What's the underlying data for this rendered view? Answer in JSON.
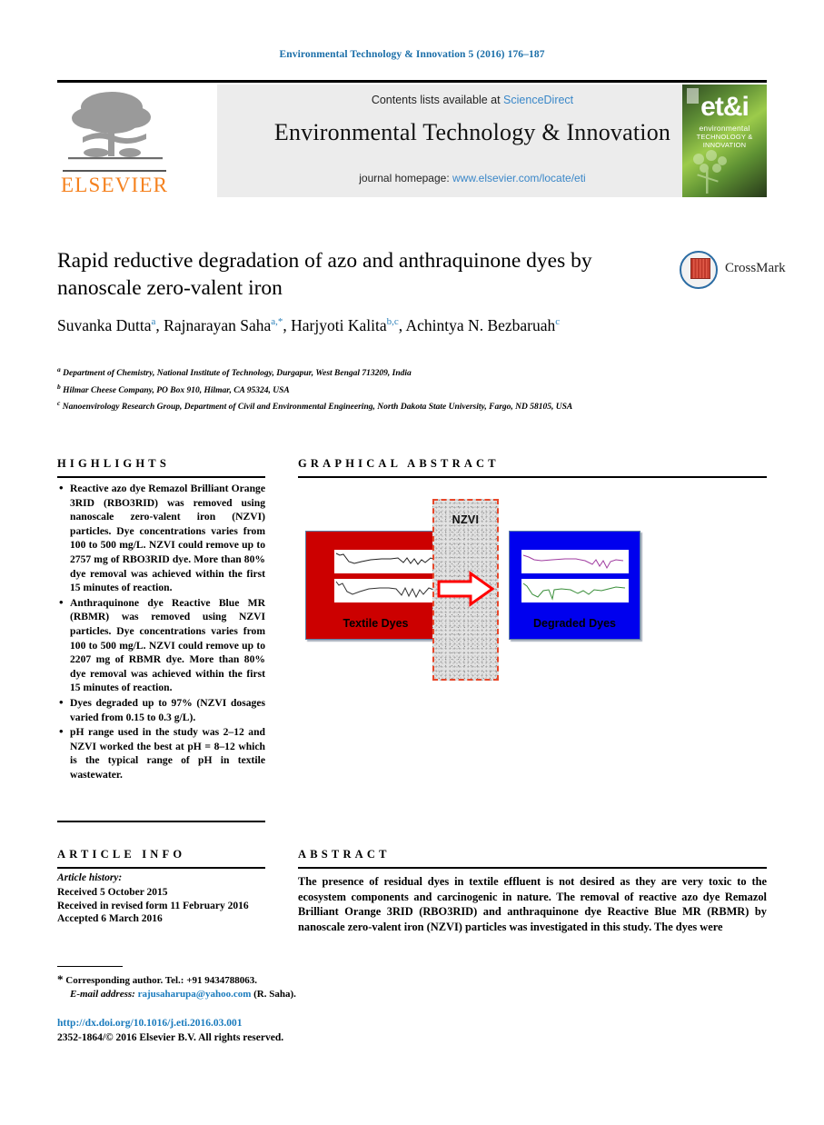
{
  "running_head": "Environmental Technology & Innovation 5 (2016) 176–187",
  "banner": {
    "contents_prefix": "Contents lists available at ",
    "contents_link": "ScienceDirect",
    "journal_title": "Environmental Technology & Innovation",
    "homepage_prefix": "journal homepage: ",
    "homepage_link": "www.elsevier.com/locate/eti",
    "publisher_logo_text": "ELSEVIER",
    "cover": {
      "logo_text": "et&i",
      "line1": "environmental",
      "line2": "TECHNOLOGY &",
      "line3": "INNOVATION"
    }
  },
  "article": {
    "title": "Rapid reductive degradation of azo and anthraquinone dyes by nanoscale zero-valent iron",
    "crossmark_label": "CrossMark",
    "authors": [
      {
        "name": "Suvanka Dutta",
        "marks": "a",
        "sep": ", "
      },
      {
        "name": "Rajnarayan Saha",
        "marks": "a,*",
        "sep": ", "
      },
      {
        "name": "Harjyoti Kalita",
        "marks": "b,c",
        "sep": ", "
      },
      {
        "name": "Achintya N. Bezbaruah",
        "marks": "c",
        "sep": ""
      }
    ],
    "affiliations": [
      {
        "mark": "a",
        "text": "Department of Chemistry, National Institute of Technology, Durgapur, West Bengal 713209, India"
      },
      {
        "mark": "b",
        "text": "Hilmar Cheese Company, PO Box 910, Hilmar, CA 95324, USA"
      },
      {
        "mark": "c",
        "text": "Nanoenvirology Research Group, Department of Civil and Environmental Engineering, North Dakota State University, Fargo, ND 58105, USA"
      }
    ]
  },
  "sections": {
    "highlights_head": "HIGHLIGHTS",
    "graphical_abstract_head": "GRAPHICAL ABSTRACT",
    "article_info_head": "ARTICLE INFO",
    "abstract_head": "ABSTRACT"
  },
  "highlights": [
    "Reactive azo dye Remazol Brilliant Orange 3RID (RBO3RID) was removed using nanoscale zero-valent iron (NZVI) particles. Dye concentrations varies from 100 to 500 mg/L. NZVI could remove up to 2757 mg of RBO3RID dye. More than 80% dye removal was achieved within the first 15 minutes of reaction.",
    "Anthraquinone dye Reactive Blue MR (RBMR) was removed using NZVI particles. Dye concentrations varies from 100 to 500 mg/L. NZVI could remove up to 2207 mg of RBMR dye. More than 80% dye removal was achieved within the first 15 minutes of reaction.",
    "Dyes degraded up to 97% (NZVI dosages varied from 0.15 to 0.3 g/L).",
    "pH range used in the study was 2–12 and NZVI worked the best at pH = 8–12 which is the typical range of pH in textile wastewater."
  ],
  "graphical_abstract": {
    "left_label": "Textile Dyes",
    "middle_label": "NZVI",
    "right_label": "Degraded Dyes",
    "colors": {
      "left_box": "#CC0000",
      "right_box": "#0000EE",
      "barrier_border": "#e8472a",
      "barrier_fill": "#e2e2e2",
      "arrow_outline": "#ff0000"
    }
  },
  "article_info": {
    "history_label": "Article history:",
    "history": [
      "Received 5 October 2015",
      "Received in revised form 11 February 2016",
      "Accepted 6 March 2016"
    ]
  },
  "abstract_text": "The presence of residual dyes in textile effluent is not desired as they are very toxic to the ecosystem components and carcinogenic in nature. The removal of reactive azo dye Remazol Brilliant Orange 3RID (RBO3RID) and anthraquinone dye Reactive Blue MR (RBMR) by nanoscale zero-valent iron (NZVI) particles was investigated in this study. The dyes were",
  "footer": {
    "corresponding_star": "*",
    "corresponding_text": "Corresponding author. Tel.: +91 9434788063.",
    "email_label": "E-mail address:",
    "email": "rajusaharupa@yahoo.com",
    "email_suffix": "(R. Saha).",
    "doi": "http://dx.doi.org/10.1016/j.eti.2016.03.001",
    "copyright": "2352-1864/© 2016 Elsevier B.V. All rights reserved."
  }
}
